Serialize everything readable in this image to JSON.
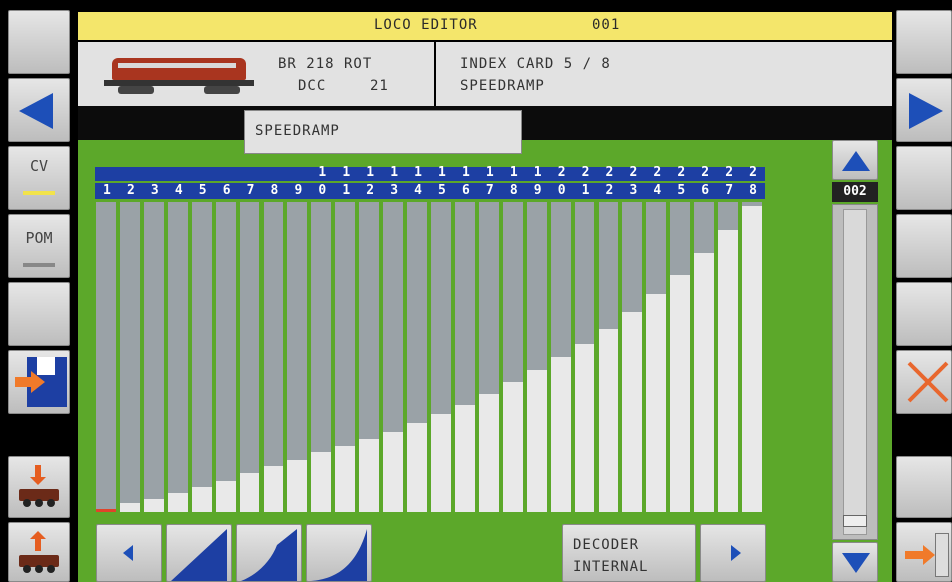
{
  "header": {
    "title": "LOCO EDITOR",
    "loco_number": "001"
  },
  "loco": {
    "name": "BR 218 ROT",
    "protocol": "DCC",
    "address": "21"
  },
  "card": {
    "line1": "INDEX CARD 5 / 8",
    "line2": "SPEEDRAMP"
  },
  "tab_label": "SPEEDRAMP",
  "left_sidebar": {
    "cv_label": "CV",
    "pom_label": "POM"
  },
  "scroll": {
    "value": "002"
  },
  "speed_steps": {
    "top_digits": [
      "",
      "",
      "",
      "",
      "",
      "",
      "",
      "",
      "",
      "1",
      "1",
      "1",
      "1",
      "1",
      "1",
      "1",
      "1",
      "1",
      "1",
      "2",
      "2",
      "2",
      "2",
      "2",
      "2",
      "2",
      "2",
      "2"
    ],
    "bottom_digits": [
      "1",
      "2",
      "3",
      "4",
      "5",
      "6",
      "7",
      "8",
      "9",
      "0",
      "1",
      "2",
      "3",
      "4",
      "5",
      "6",
      "7",
      "8",
      "9",
      "0",
      "1",
      "2",
      "3",
      "4",
      "5",
      "6",
      "7",
      "8"
    ],
    "values": [
      2,
      6,
      9,
      13,
      17,
      21,
      26,
      31,
      35,
      40,
      44,
      49,
      54,
      60,
      66,
      72,
      79,
      87,
      95,
      104,
      113,
      123,
      134,
      146,
      159,
      174,
      189,
      205
    ],
    "max": 208,
    "selected_step": 1
  },
  "bottom": {
    "decoder_line1": "DECODER",
    "decoder_line2": "INTERNAL"
  },
  "colors": {
    "background": "#5ca82a",
    "accent_blue": "#1d3fa3",
    "title_bar": "#f4e66b",
    "bar_fill": "#e9e9e9",
    "bar_empty": "#9aa2a7",
    "selected_marker": "#e0442a"
  }
}
